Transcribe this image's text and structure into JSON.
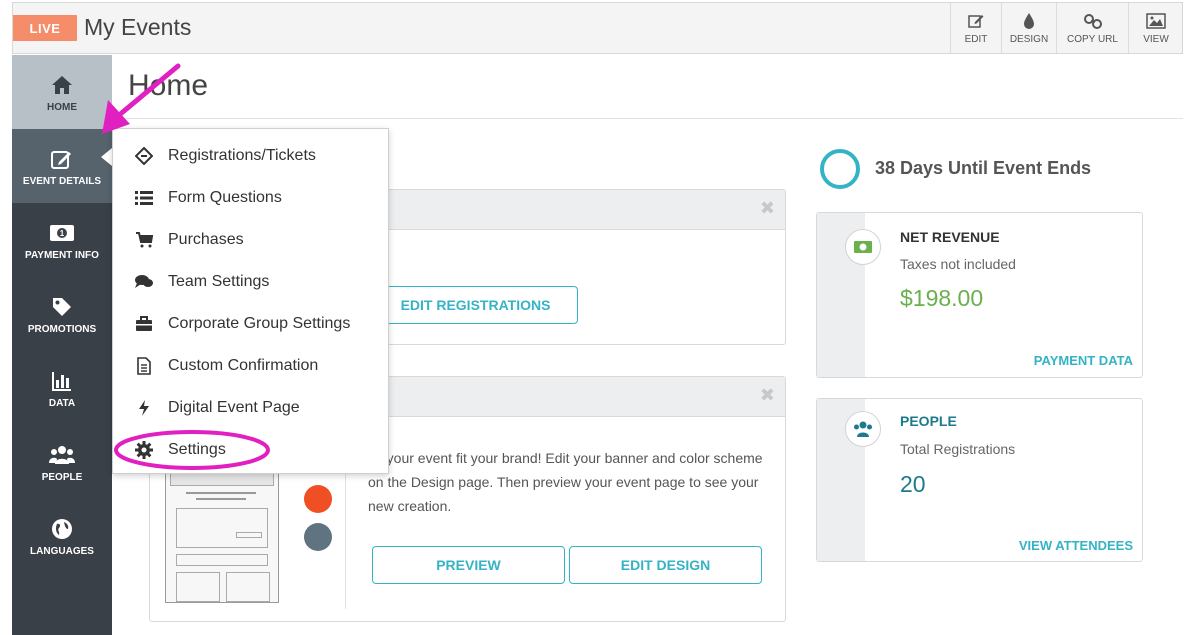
{
  "header": {
    "live_label": "LIVE",
    "title": "My Events",
    "buttons": [
      {
        "label": "EDIT",
        "icon": "edit-icon"
      },
      {
        "label": "DESIGN",
        "icon": "drop-icon"
      },
      {
        "label": "COPY URL",
        "icon": "link-icon"
      },
      {
        "label": "VIEW",
        "icon": "image-icon"
      }
    ]
  },
  "sidebar": {
    "items": [
      {
        "label": "HOME",
        "icon": "home-icon"
      },
      {
        "label": "EVENT DETAILS",
        "icon": "edit-icon"
      },
      {
        "label": "PAYMENT INFO",
        "icon": "money-icon"
      },
      {
        "label": "PROMOTIONS",
        "icon": "tag-icon"
      },
      {
        "label": "DATA",
        "icon": "bar-chart-icon"
      },
      {
        "label": "PEOPLE",
        "icon": "people-icon"
      },
      {
        "label": "LANGUAGES",
        "icon": "globe-icon"
      }
    ]
  },
  "main": {
    "page_title": "Home",
    "countdown": "38 Days Until Event Ends",
    "registrations_card": {
      "button": "EDIT REGISTRATIONS"
    },
    "design_card": {
      "text": "ke your event fit your brand! Edit your banner and color scheme on the Design page. Then preview your event page to see your new creation.",
      "preview_button": "PREVIEW",
      "edit_design_button": "EDIT DESIGN"
    },
    "revenue_card": {
      "label": "NET REVENUE",
      "sub": "Taxes not included",
      "value": "$198.00",
      "link": "PAYMENT DATA"
    },
    "people_card": {
      "label": "PEOPLE",
      "sub": "Total Registrations",
      "value": "20",
      "link": "VIEW ATTENDEES"
    }
  },
  "dropdown": {
    "items": [
      {
        "label": "Registrations/Tickets",
        "icon": "ticket-icon"
      },
      {
        "label": "Form Questions",
        "icon": "list-icon"
      },
      {
        "label": "Purchases",
        "icon": "cart-icon"
      },
      {
        "label": "Team Settings",
        "icon": "chat-icon"
      },
      {
        "label": "Corporate Group Settings",
        "icon": "briefcase-icon"
      },
      {
        "label": "Custom Confirmation",
        "icon": "document-icon"
      },
      {
        "label": "Digital Event Page",
        "icon": "bolt-icon"
      },
      {
        "label": "Settings",
        "icon": "gear-icon"
      }
    ]
  },
  "colors": {
    "accent": "#35b3c6",
    "sidebar": "#3a4047",
    "live": "#f58d6a",
    "annotation": "#e020c0",
    "revenue_value": "#6ab04c",
    "people_value": "#1d7a8c"
  }
}
